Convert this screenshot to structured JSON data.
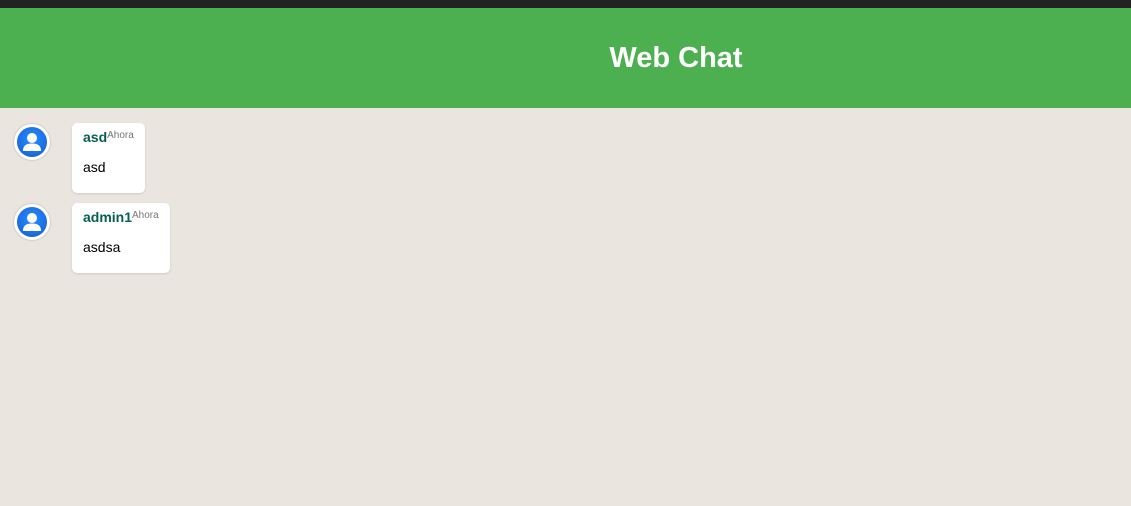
{
  "header": {
    "title": "Web Chat"
  },
  "colors": {
    "header_bg": "#4caf50",
    "chat_bg": "#ebe5df",
    "username": "#075e54"
  },
  "messages": [
    {
      "avatar_icon": "user-avatar-icon",
      "username": "asd",
      "time": "Ahora",
      "text": "asd"
    },
    {
      "avatar_icon": "user-avatar-icon",
      "username": "admin1",
      "time": "Ahora",
      "text": "asdsa"
    }
  ]
}
